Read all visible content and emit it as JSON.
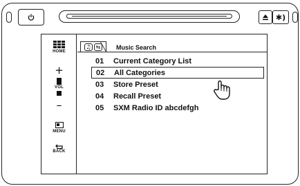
{
  "top_strip": {
    "power_icon": "power-icon",
    "eject_icon": "eject-icon",
    "mute_icon": "mute-icon",
    "mute_label": "✱)"
  },
  "sidebar": {
    "home_label": "HOME",
    "vol_plus": "+",
    "vol_label": "VOL",
    "vol_minus": "–",
    "menu_label": "MENU",
    "back_label": "BACK",
    "back_glyph": "⮌"
  },
  "screen": {
    "title": "Music Search",
    "tab_icons": [
      "note-icon",
      "return-icon"
    ],
    "items": [
      {
        "num": "01",
        "label": "Current Category List",
        "selected": false
      },
      {
        "num": "02",
        "label": "All Categories",
        "selected": true
      },
      {
        "num": "03",
        "label": "Store Preset",
        "selected": false
      },
      {
        "num": "04",
        "label": "Recall Preset",
        "selected": false
      },
      {
        "num": "05",
        "label": "SXM Radio ID abcdefgh",
        "selected": false
      }
    ]
  }
}
